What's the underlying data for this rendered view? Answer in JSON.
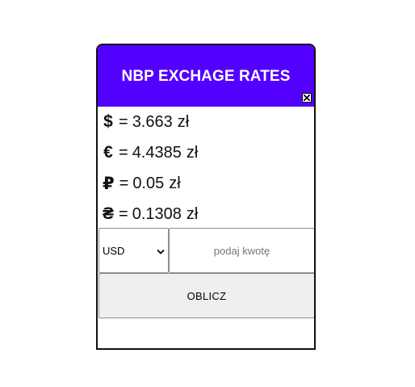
{
  "header": {
    "title": "NBP EXCHAGE RATES"
  },
  "rates": [
    {
      "symbol": "$",
      "value": "3.663",
      "unit": "zł"
    },
    {
      "symbol": "€",
      "value": "4.4385",
      "unit": "zł"
    },
    {
      "symbol": "₽",
      "value": "0.05",
      "unit": "zł"
    },
    {
      "symbol": "₴",
      "value": "0.1308",
      "unit": "zł"
    }
  ],
  "form": {
    "currency_selected": "USD",
    "amount_placeholder": "podaj kwotę",
    "calculate_label": "OBLICZ"
  },
  "colors": {
    "header_bg": "#5200ff",
    "header_text": "#ffffff",
    "button_bg": "#efefef"
  },
  "icons": {
    "close": "close-icon",
    "dropdown": "chevron-down-icon"
  }
}
